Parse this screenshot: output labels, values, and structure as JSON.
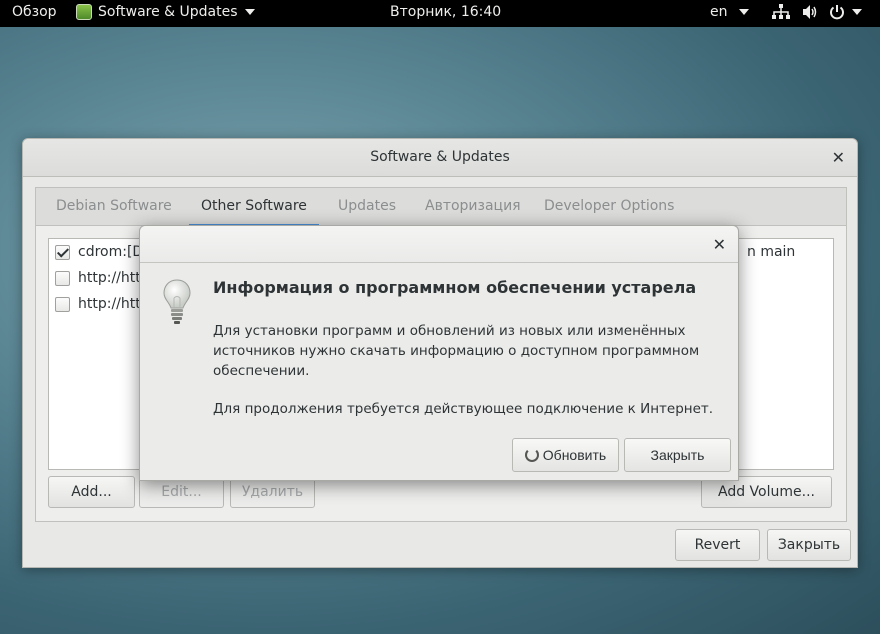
{
  "topbar": {
    "activities": "Обзор",
    "app_menu": "Software & Updates",
    "clock": "Вторник, 16:40",
    "language": "en"
  },
  "main_window": {
    "title": "Software & Updates",
    "tabs": [
      {
        "label": "Debian Software",
        "active": false
      },
      {
        "label": "Other Software",
        "active": true
      },
      {
        "label": "Updates",
        "active": false
      },
      {
        "label": "Авторизация",
        "active": false
      },
      {
        "label": "Developer Options",
        "active": false
      }
    ],
    "sources": [
      {
        "label": "cdrom:[D",
        "checked": true
      },
      {
        "label": "http://htt",
        "checked": false
      },
      {
        "label": "http://htt",
        "checked": false
      }
    ],
    "source_tail": "n main",
    "buttons": {
      "add": "Add...",
      "edit": "Edit...",
      "remove": "Удалить",
      "add_volume": "Add Volume...",
      "revert": "Revert",
      "close": "Закрыть"
    }
  },
  "dialog": {
    "heading": "Информация о программном обеспечении устарела",
    "body_line1": "Для установки программ и обновлений из новых или изменённых",
    "body_line2": "источников нужно скачать информацию о доступном программном",
    "body_line3": "обеспечении.",
    "body_second": "Для продолжения требуется действующее подключение к Интернет.",
    "refresh_label": "Обновить",
    "close_label": "Закрыть"
  },
  "colors": {
    "accent": "#4a90d9",
    "topbar": "#000000"
  }
}
